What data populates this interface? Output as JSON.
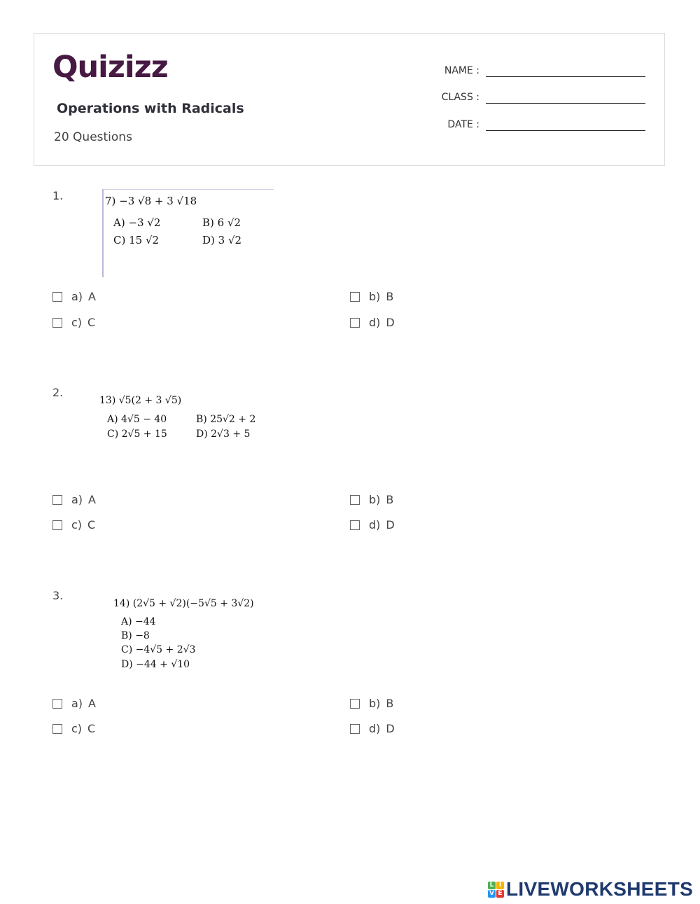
{
  "header": {
    "logo_text": "Quizizz",
    "brand_color": "#461a42",
    "quiz_title": "Operations with Radicals",
    "question_count": "20 Questions",
    "fields": [
      {
        "label": "NAME :"
      },
      {
        "label": "CLASS :"
      },
      {
        "label": "DATE :"
      }
    ]
  },
  "questions": [
    {
      "number": "1.",
      "image": {
        "stem": "7)  −3 √8 + 3 √18",
        "choices": [
          "A)  −3 √2",
          "B)  6 √2",
          "C)  15 √2",
          "D)  3 √2"
        ]
      },
      "options": [
        {
          "letter": "a)",
          "text": "A"
        },
        {
          "letter": "b)",
          "text": "B"
        },
        {
          "letter": "c)",
          "text": "C"
        },
        {
          "letter": "d)",
          "text": "D"
        }
      ]
    },
    {
      "number": "2.",
      "image": {
        "stem": "13)  √5(2 + 3 √5)",
        "choices": [
          "A)  4√5 − 40",
          "B)  25√2 + 2",
          "C)  2√5 + 15",
          "D)  2√3 + 5"
        ]
      },
      "options": [
        {
          "letter": "a)",
          "text": "A"
        },
        {
          "letter": "b)",
          "text": "B"
        },
        {
          "letter": "c)",
          "text": "C"
        },
        {
          "letter": "d)",
          "text": "D"
        }
      ]
    },
    {
      "number": "3.",
      "image": {
        "stem": "14)  (2√5 + √2)(−5√5 + 3√2)",
        "choices": [
          "A)  −44",
          "B)  −8",
          "C)  −4√5 + 2√3",
          "D)  −44 + √10"
        ]
      },
      "options": [
        {
          "letter": "a)",
          "text": "A"
        },
        {
          "letter": "b)",
          "text": "B"
        },
        {
          "letter": "c)",
          "text": "C"
        },
        {
          "letter": "d)",
          "text": "D"
        }
      ]
    }
  ],
  "footer": {
    "tile_letters": [
      "L",
      "I",
      "V",
      "E"
    ],
    "tile_colors": [
      "#4caf50",
      "#f5b400",
      "#2196f3",
      "#e53935"
    ],
    "brand_text": "LIVEWORKSHEETS",
    "brand_color": "#1f3a6e"
  }
}
